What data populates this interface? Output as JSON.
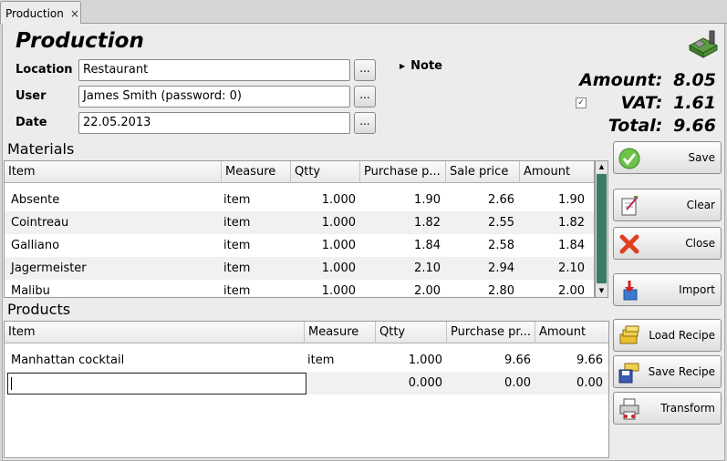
{
  "tab": {
    "label": "Production",
    "close": "×"
  },
  "title": "Production",
  "form": {
    "location": {
      "label": "Location",
      "value": "Restaurant"
    },
    "user": {
      "label": "User",
      "value": "James Smith (password: 0)"
    },
    "date": {
      "label": "Date",
      "value": "22.05.2013"
    },
    "browse": "..."
  },
  "note_label": "Note",
  "totals": {
    "amount_label": "Amount:",
    "amount": "8.05",
    "vat_label": "VAT:",
    "vat": "1.61",
    "vat_checked": true,
    "total_label": "Total:",
    "total": "9.66"
  },
  "materials": {
    "title": "Materials",
    "columns": [
      "Item",
      "Measure",
      "Qtty",
      "Purchase p...",
      "Sale price",
      "Amount"
    ],
    "rows": [
      [
        "Absente",
        "item",
        "1.000",
        "1.90",
        "2.66",
        "1.90"
      ],
      [
        "Cointreau",
        "item",
        "1.000",
        "1.82",
        "2.55",
        "1.82"
      ],
      [
        "Galliano",
        "item",
        "1.000",
        "1.84",
        "2.58",
        "1.84"
      ],
      [
        "Jagermeister",
        "item",
        "1.000",
        "2.10",
        "2.94",
        "2.10"
      ],
      [
        "Malibu",
        "item",
        "1.000",
        "2.00",
        "2.80",
        "2.00"
      ]
    ]
  },
  "products": {
    "title": "Products",
    "columns": [
      "Item",
      "Measure",
      "Qtty",
      "Purchase pr...",
      "Amount"
    ],
    "rows": [
      [
        "Manhattan cocktail",
        "item",
        "1.000",
        "9.66",
        "9.66"
      ],
      [
        "",
        "",
        "0.000",
        "0.00",
        "0.00"
      ]
    ]
  },
  "buttons": {
    "save": "Save",
    "clear": "Clear",
    "close": "Close",
    "import": "Import",
    "load_recipe": "Load Recipe",
    "save_recipe": "Save Recipe",
    "transform": "Transform"
  },
  "colors": {
    "scrollbar_thumb": "#3b7a64",
    "save_icon": "#6cc24a",
    "close_icon": "#e04020"
  }
}
